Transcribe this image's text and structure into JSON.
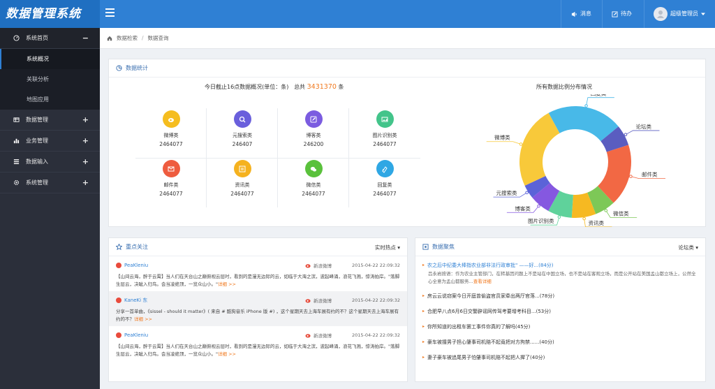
{
  "header": {
    "logo": "数据管理系统",
    "message_label": "消息",
    "todo_label": "待办",
    "user_label": "超级管理员"
  },
  "sidebar": {
    "items": [
      {
        "label": "系统首页",
        "icon": "dashboard-icon",
        "toggle": "−"
      },
      {
        "label": "数据管理",
        "icon": "table-icon",
        "toggle": "+"
      },
      {
        "label": "业务管理",
        "icon": "bar-chart-icon",
        "toggle": "+"
      },
      {
        "label": "数据输入",
        "icon": "list-icon",
        "toggle": "+"
      },
      {
        "label": "系统管理",
        "icon": "gear-icon",
        "toggle": "+"
      }
    ],
    "sub_items": [
      "系统概况",
      "关联分析",
      "地图应用"
    ]
  },
  "breadcrumb": {
    "home": "数据检索",
    "sep": "/",
    "current": "数据查询"
  },
  "stats": {
    "title": "数据统计",
    "summary_prefix": "今日截止16点数据概况(单位：条)",
    "total_label": "总共",
    "total_value": "3431370",
    "total_unit": "条",
    "cells": [
      {
        "label": "微博类",
        "value": "2464077",
        "color": "#f5bd1f",
        "icon": "weibo-icon"
      },
      {
        "label": "元搜索类",
        "value": "246407",
        "color": "#6a5fdc",
        "icon": "search-icon"
      },
      {
        "label": "博客类",
        "value": "246200",
        "color": "#7b5ce0",
        "icon": "edit-icon"
      },
      {
        "label": "图片识别类",
        "value": "2464077",
        "color": "#43c48a",
        "icon": "image-icon"
      },
      {
        "label": "邮件类",
        "value": "2464077",
        "color": "#ee5c3f",
        "icon": "mail-icon"
      },
      {
        "label": "资讯类",
        "value": "2464077",
        "color": "#f5b21f",
        "icon": "news-icon"
      },
      {
        "label": "微信类",
        "value": "2464077",
        "color": "#5ac13c",
        "icon": "wechat-icon"
      },
      {
        "label": "回复类",
        "value": "2464077",
        "color": "#2fa7e4",
        "icon": "reply-icon"
      }
    ]
  },
  "chart_data": {
    "type": "pie",
    "title": "所有数据比例分布情况",
    "categories": [
      "回复类",
      "论坛类",
      "邮件类",
      "微信类",
      "资讯类",
      "图片识别类",
      "博客类",
      "元搜索类",
      "微博类"
    ],
    "values": [
      22,
      6,
      18,
      6,
      7,
      7,
      6,
      4,
      24
    ],
    "colors": [
      "#48b9e8",
      "#5a5dc0",
      "#f26844",
      "#7dc857",
      "#f6b922",
      "#5fd29b",
      "#8558e0",
      "#5b63d8",
      "#f8c93a"
    ]
  },
  "focus": {
    "title": "重点关注",
    "dropdown": "实时热点",
    "posts": [
      {
        "user": "PeaKleniu",
        "source": "新浪微博",
        "time": "2015-04-22 22:09:32",
        "text": "【山间云海，醉于云霄】当人们在天台山之巅俯视云层时，看到的是漫无边际的云，如临于大海之滨，波起峰涌，浪花飞溅，惊涛拍岸。\"落脚生层云，决眦入归鸟。会当凌绝顶，一览众山小。\"",
        "more": "详细 >>"
      },
      {
        "user": "KaneKi 东",
        "source": "新浪微博",
        "time": "2015-04-22 22:09:32",
        "text": "分享一首单曲，《sissel - should it matter》( 来自 # 酷狗音乐 iPhone 版 #) ，这个星期天去上海车展有约的不？这个星期天去上海车展有约的不？",
        "more": "详细 >>"
      },
      {
        "user": "PeaKleniu",
        "source": "新浪微博",
        "time": "2015-04-22 22:09:32",
        "text": "【山间云海，醉于云霄】当人们在天台山之巅俯视云层时，看到的是漫无边际的云，如临于大海之滨，波起峰涌，浪花飞溅，惊涛拍岸。\"落脚生层云，决眦入归鸟。会当凌绝顶，一览众山小。\"",
        "more": "详细 >>"
      }
    ]
  },
  "datafeed": {
    "title": "数据聚焦",
    "dropdown": "论坛类",
    "first_headline": "农之后中纪委大棒指农业部非法行政审批\" ——好...(84分)",
    "first_desc": "吕永岩按语：作为农业主管部门，在转基因问题上不是站在中国立场，也不是站在客观立场，而是公开站在美国孟山都立场上，公然全心全意为孟山都服务...",
    "first_more": "查看详细",
    "headlines": [
      "房云云说窃案今日开庭曾偷盗官员家牵出两厅官落...(78分)",
      "合肥早八点6月6日交警辟谣网传驾考要增考科目...(53分)",
      "你所知道的出租车罢工事件你真的了解吗(45分)",
      "豪车被撞男子担心肇事司机赔不起竟把对方拘禁......(40分)",
      "妻子豪车被追尾男子怕肇事司机赔不起把人撵了(40分)"
    ]
  }
}
